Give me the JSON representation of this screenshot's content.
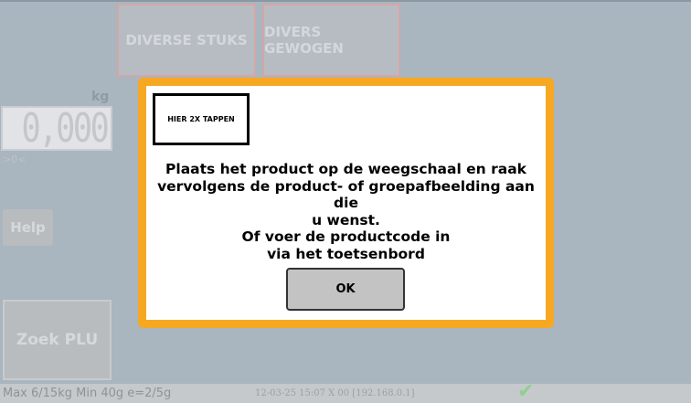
{
  "categories": [
    "DIVERSE STUKS",
    "DIVERS GEWOGEN"
  ],
  "scale": {
    "unit": "kg",
    "weight": "0,000",
    "zero_indicator": ">0<"
  },
  "buttons": {
    "help": "Help",
    "zoek_plu": "Zoek PLU"
  },
  "status": {
    "capacity": "Max 6/15kg Min 40g e=2/5g",
    "info": "12-03-25 15:07 X 00 [192.168.0.1]",
    "check_icon": "checkmark-icon",
    "check_color": "#8fd18f"
  },
  "dialog": {
    "tap_label": "HIER 2X TAPPEN",
    "message_lines": [
      "Plaats het product op de weegschaal en raak",
      "vervolgens de product- of groepafbeelding aan die",
      "u wenst.",
      "Of voer de productcode in",
      "via het toetsenbord"
    ],
    "ok_label": "OK",
    "border_color": "#f7a823"
  }
}
